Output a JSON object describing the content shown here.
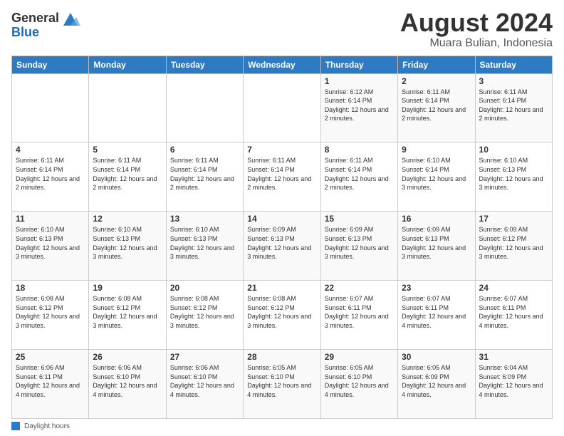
{
  "logo": {
    "general": "General",
    "blue": "Blue"
  },
  "title": "August 2024",
  "subtitle": "Muara Bulian, Indonesia",
  "days_of_week": [
    "Sunday",
    "Monday",
    "Tuesday",
    "Wednesday",
    "Thursday",
    "Friday",
    "Saturday"
  ],
  "weeks": [
    [
      {
        "day": "",
        "info": ""
      },
      {
        "day": "",
        "info": ""
      },
      {
        "day": "",
        "info": ""
      },
      {
        "day": "",
        "info": ""
      },
      {
        "day": "1",
        "info": "Sunrise: 6:12 AM\nSunset: 6:14 PM\nDaylight: 12 hours and 2 minutes."
      },
      {
        "day": "2",
        "info": "Sunrise: 6:11 AM\nSunset: 6:14 PM\nDaylight: 12 hours and 2 minutes."
      },
      {
        "day": "3",
        "info": "Sunrise: 6:11 AM\nSunset: 6:14 PM\nDaylight: 12 hours and 2 minutes."
      }
    ],
    [
      {
        "day": "4",
        "info": "Sunrise: 6:11 AM\nSunset: 6:14 PM\nDaylight: 12 hours and 2 minutes."
      },
      {
        "day": "5",
        "info": "Sunrise: 6:11 AM\nSunset: 6:14 PM\nDaylight: 12 hours and 2 minutes."
      },
      {
        "day": "6",
        "info": "Sunrise: 6:11 AM\nSunset: 6:14 PM\nDaylight: 12 hours and 2 minutes."
      },
      {
        "day": "7",
        "info": "Sunrise: 6:11 AM\nSunset: 6:14 PM\nDaylight: 12 hours and 2 minutes."
      },
      {
        "day": "8",
        "info": "Sunrise: 6:11 AM\nSunset: 6:14 PM\nDaylight: 12 hours and 2 minutes."
      },
      {
        "day": "9",
        "info": "Sunrise: 6:10 AM\nSunset: 6:14 PM\nDaylight: 12 hours and 3 minutes."
      },
      {
        "day": "10",
        "info": "Sunrise: 6:10 AM\nSunset: 6:13 PM\nDaylight: 12 hours and 3 minutes."
      }
    ],
    [
      {
        "day": "11",
        "info": "Sunrise: 6:10 AM\nSunset: 6:13 PM\nDaylight: 12 hours and 3 minutes."
      },
      {
        "day": "12",
        "info": "Sunrise: 6:10 AM\nSunset: 6:13 PM\nDaylight: 12 hours and 3 minutes."
      },
      {
        "day": "13",
        "info": "Sunrise: 6:10 AM\nSunset: 6:13 PM\nDaylight: 12 hours and 3 minutes."
      },
      {
        "day": "14",
        "info": "Sunrise: 6:09 AM\nSunset: 6:13 PM\nDaylight: 12 hours and 3 minutes."
      },
      {
        "day": "15",
        "info": "Sunrise: 6:09 AM\nSunset: 6:13 PM\nDaylight: 12 hours and 3 minutes."
      },
      {
        "day": "16",
        "info": "Sunrise: 6:09 AM\nSunset: 6:13 PM\nDaylight: 12 hours and 3 minutes."
      },
      {
        "day": "17",
        "info": "Sunrise: 6:09 AM\nSunset: 6:12 PM\nDaylight: 12 hours and 3 minutes."
      }
    ],
    [
      {
        "day": "18",
        "info": "Sunrise: 6:08 AM\nSunset: 6:12 PM\nDaylight: 12 hours and 3 minutes."
      },
      {
        "day": "19",
        "info": "Sunrise: 6:08 AM\nSunset: 6:12 PM\nDaylight: 12 hours and 3 minutes."
      },
      {
        "day": "20",
        "info": "Sunrise: 6:08 AM\nSunset: 6:12 PM\nDaylight: 12 hours and 3 minutes."
      },
      {
        "day": "21",
        "info": "Sunrise: 6:08 AM\nSunset: 6:12 PM\nDaylight: 12 hours and 3 minutes."
      },
      {
        "day": "22",
        "info": "Sunrise: 6:07 AM\nSunset: 6:11 PM\nDaylight: 12 hours and 3 minutes."
      },
      {
        "day": "23",
        "info": "Sunrise: 6:07 AM\nSunset: 6:11 PM\nDaylight: 12 hours and 4 minutes."
      },
      {
        "day": "24",
        "info": "Sunrise: 6:07 AM\nSunset: 6:11 PM\nDaylight: 12 hours and 4 minutes."
      }
    ],
    [
      {
        "day": "25",
        "info": "Sunrise: 6:06 AM\nSunset: 6:11 PM\nDaylight: 12 hours and 4 minutes."
      },
      {
        "day": "26",
        "info": "Sunrise: 6:06 AM\nSunset: 6:10 PM\nDaylight: 12 hours and 4 minutes."
      },
      {
        "day": "27",
        "info": "Sunrise: 6:06 AM\nSunset: 6:10 PM\nDaylight: 12 hours and 4 minutes."
      },
      {
        "day": "28",
        "info": "Sunrise: 6:05 AM\nSunset: 6:10 PM\nDaylight: 12 hours and 4 minutes."
      },
      {
        "day": "29",
        "info": "Sunrise: 6:05 AM\nSunset: 6:10 PM\nDaylight: 12 hours and 4 minutes."
      },
      {
        "day": "30",
        "info": "Sunrise: 6:05 AM\nSunset: 6:09 PM\nDaylight: 12 hours and 4 minutes."
      },
      {
        "day": "31",
        "info": "Sunrise: 6:04 AM\nSunset: 6:09 PM\nDaylight: 12 hours and 4 minutes."
      }
    ]
  ],
  "footer": {
    "label": "Daylight hours"
  }
}
